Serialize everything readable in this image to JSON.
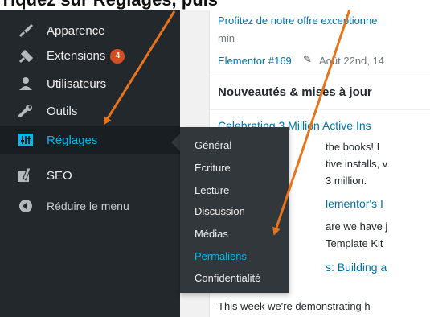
{
  "caption": {
    "text": "Tiquez sur Réglages, puis Permaliens"
  },
  "sidebar": {
    "items": [
      {
        "label": "Apparence",
        "icon": "paintbrush-icon"
      },
      {
        "label": "Extensions",
        "icon": "plugin-icon",
        "badge": "4"
      },
      {
        "label": "Utilisateurs",
        "icon": "users-icon"
      },
      {
        "label": "Outils",
        "icon": "wrench-icon"
      },
      {
        "label": "Réglages",
        "icon": "settings-icon"
      },
      {
        "label": "SEO",
        "icon": "yoast-seo-icon"
      },
      {
        "label": "Réduire le menu",
        "icon": "collapse-icon"
      }
    ]
  },
  "submenu": {
    "items": [
      "Général",
      "Écriture",
      "Lecture",
      "Discussion",
      "Médias",
      "Permaliens",
      "Confidentialité"
    ],
    "current": "Permaliens"
  },
  "content": {
    "promo_text": "Profitez de notre offre exceptionne",
    "promo_text_2": "min",
    "elementor_line": "Elementor #169",
    "elementor_date": "Août 22nd, 14",
    "news_heading": "Nouveautés & mises à jour",
    "news_title_1": "Celebrating 3 Million Active Ins",
    "news_body_1a": "the books! I",
    "news_body_1b": "tive installs, v",
    "news_body_1c": "3 million.",
    "news_title_2": "lementor's I",
    "news_body_2a": "are we have j",
    "news_body_2b": "Template Kit",
    "news_title_3": "s: Building a",
    "news_body_3": "This week we're demonstrating h"
  },
  "colors": {
    "sidebar_bg": "#23282d",
    "submenu_bg": "#32373c",
    "accent_blue": "#0073aa",
    "highlight_blue": "#00b9eb",
    "badge_orange": "#d54e21",
    "arrow_orange": "#e8731a"
  }
}
